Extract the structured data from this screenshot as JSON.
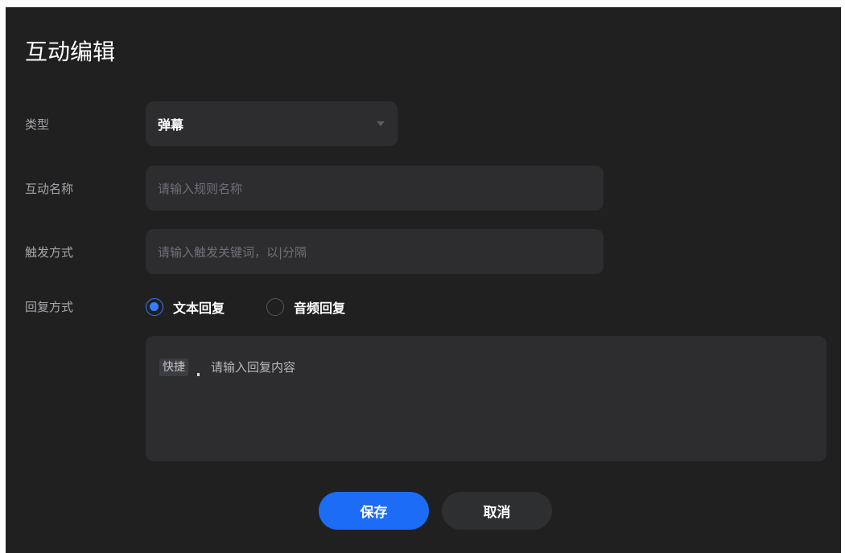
{
  "dialog": {
    "title": "互动编辑",
    "fields": {
      "type": {
        "label": "类型",
        "value": "弹幕"
      },
      "name": {
        "label": "互动名称",
        "placeholder": "请输入规则名称"
      },
      "trigger": {
        "label": "触发方式",
        "placeholder": "请输入触发关键词，以|分隔"
      },
      "reply_mode": {
        "label": "回复方式",
        "options": [
          {
            "label": "文本回复",
            "checked": true
          },
          {
            "label": "音频回复",
            "checked": false
          }
        ]
      },
      "reply_content": {
        "tag": "快捷",
        "placeholder": "请输入回复内容"
      }
    },
    "buttons": {
      "save": "保存",
      "cancel": "取消"
    }
  },
  "colors": {
    "background": "#202021",
    "field": "#2d2d2f",
    "accent": "#1c6cf6",
    "radio": "#3a7bff"
  }
}
